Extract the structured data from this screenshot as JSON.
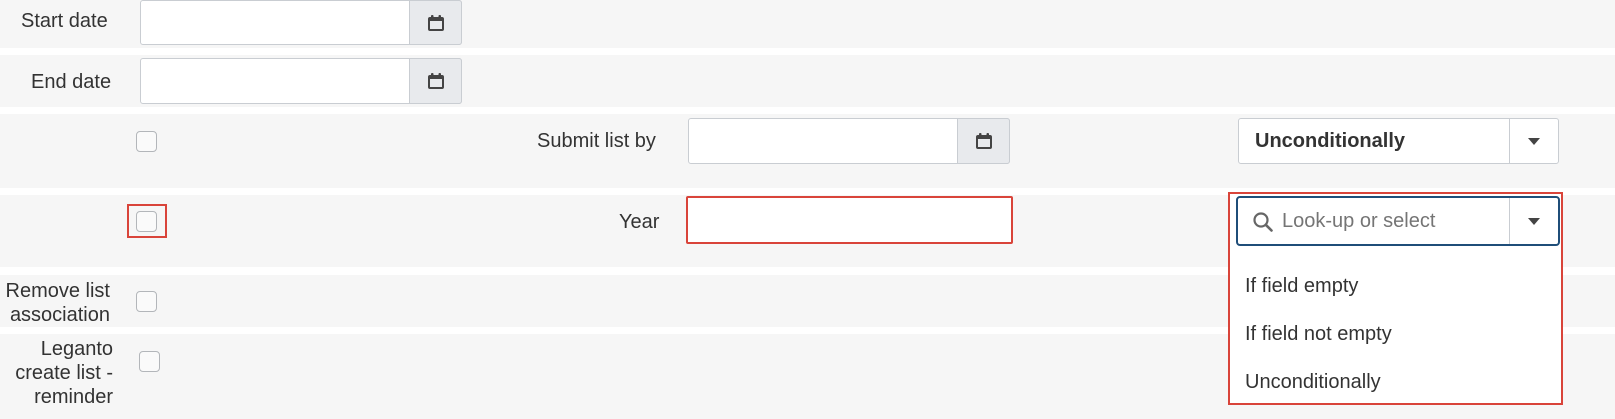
{
  "form": {
    "start_date": {
      "label": "Start date",
      "value": ""
    },
    "end_date": {
      "label": "End date",
      "value": ""
    },
    "submit_list_by": {
      "label": "Submit list by",
      "value": "",
      "condition": "Unconditionally"
    },
    "year": {
      "label": "Year",
      "value": ""
    },
    "remove_list_association": {
      "label_line1": "Remove list",
      "label_line2": "association"
    },
    "leganto_reminder": {
      "label_line1": "Leganto",
      "label_line2": "create list -",
      "label_line3": "reminder"
    }
  },
  "dropdown": {
    "search_placeholder": "Look-up or select",
    "options": [
      "If field empty",
      "If field not empty",
      "Unconditionally"
    ]
  },
  "icons": {
    "calendar": "calendar-icon",
    "search": "search-icon",
    "caret": "caret-down-icon"
  },
  "colors": {
    "highlight": "#d9443a",
    "focus_border": "#1f4e79"
  }
}
